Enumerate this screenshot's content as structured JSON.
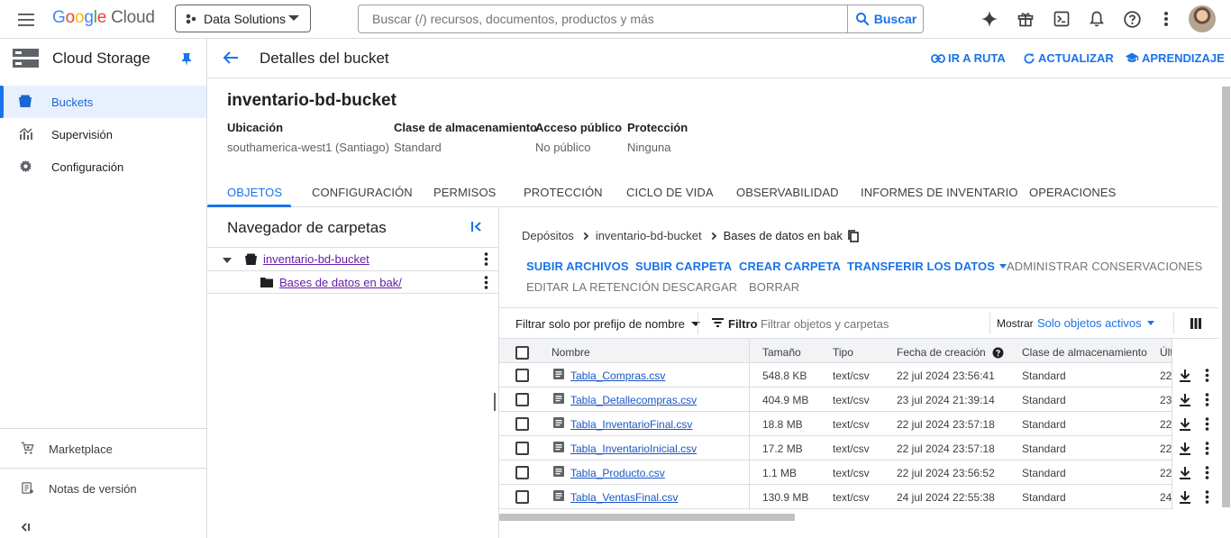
{
  "topbar": {
    "logo_letters": [
      "G",
      "o",
      "o",
      "g",
      "l",
      "e"
    ],
    "logo_suffix": "Cloud",
    "project": "Data Solutions",
    "search_placeholder": "Buscar (/) recursos, documentos, productos y más",
    "search_button": "Buscar",
    "icons": [
      "gemini-icon",
      "gift-icon",
      "cloud-shell-icon",
      "notifications-icon",
      "help-icon",
      "more-vert-icon"
    ]
  },
  "nav": {
    "product": "Cloud Storage",
    "items": [
      {
        "label": "Buckets",
        "icon": "bucket-icon",
        "active": true
      },
      {
        "label": "Supervisión",
        "icon": "monitoring-icon",
        "active": false
      },
      {
        "label": "Configuración",
        "icon": "settings-icon",
        "active": false
      }
    ],
    "bottom": [
      {
        "label": "Marketplace",
        "icon": "cart-icon"
      },
      {
        "label": "Notas de versión",
        "icon": "release-notes-icon"
      }
    ],
    "collapse": "<|"
  },
  "header": {
    "title": "Detalles del bucket",
    "actions": [
      {
        "label": "IR A RUTA",
        "icon": "link-icon"
      },
      {
        "label": "ACTUALIZAR",
        "icon": "refresh-icon"
      },
      {
        "label": "APRENDIZAJE",
        "icon": "school-icon"
      }
    ]
  },
  "bucket": {
    "name": "inventario-bd-bucket",
    "meta": [
      {
        "label": "Ubicación",
        "value": "southamerica-west1 (Santiago)"
      },
      {
        "label": "Clase de almacenamiento",
        "value": "Standard"
      },
      {
        "label": "Acceso público",
        "value": "No público"
      },
      {
        "label": "Protección",
        "value": "Ninguna"
      }
    ]
  },
  "tabs": [
    "OBJETOS",
    "CONFIGURACIÓN",
    "PERMISOS",
    "PROTECCIÓN",
    "CICLO DE VIDA",
    "OBSERVABILIDAD",
    "INFORMES DE INVENTARIO",
    "OPERACIONES"
  ],
  "folder_browser": {
    "title": "Navegador de carpetas",
    "root": "inventario-bd-bucket",
    "child": "Bases de datos en bak/"
  },
  "breadcrumb": [
    "Depósitos",
    "inventario-bd-bucket",
    "Bases de datos en bak"
  ],
  "actions": {
    "primary": [
      {
        "label": "SUBIR ARCHIVOS",
        "enabled": true
      },
      {
        "label": "SUBIR CARPETA",
        "enabled": true
      },
      {
        "label": "CREAR CARPETA",
        "enabled": true
      },
      {
        "label": "TRANSFERIR LOS DATOS",
        "enabled": true
      },
      {
        "label": "ADMINISTRAR CONSERVACIONES",
        "enabled": false
      }
    ],
    "secondary": [
      {
        "label": "EDITAR LA RETENCIÓN",
        "enabled": false
      },
      {
        "label": "DESCARGAR",
        "enabled": false
      },
      {
        "label": "BORRAR",
        "enabled": false
      }
    ]
  },
  "filter": {
    "prefix_select": "Filtrar solo por prefijo de nombre",
    "label": "Filtro",
    "placeholder": "Filtrar objetos y carpetas",
    "show_label": "Mostrar",
    "show_value": "Solo objetos activos"
  },
  "table": {
    "columns": [
      "Nombre",
      "Tamaño",
      "Tipo",
      "Fecha de creación",
      "Clase de almacenamiento",
      "Últ"
    ],
    "rows": [
      {
        "name": "Tabla_Compras.csv",
        "size": "548.8 KB",
        "type": "text/csv",
        "created": "22 jul 2024 23:56:41",
        "class": "Standard",
        "last": "22"
      },
      {
        "name": "Tabla_Detallecompras.csv",
        "size": "404.9 MB",
        "type": "text/csv",
        "created": "23 jul 2024 21:39:14",
        "class": "Standard",
        "last": "23"
      },
      {
        "name": "Tabla_InventarioFinal.csv",
        "size": "18.8 MB",
        "type": "text/csv",
        "created": "22 jul 2024 23:57:18",
        "class": "Standard",
        "last": "22"
      },
      {
        "name": "Tabla_InventarioInicial.csv",
        "size": "17.2 MB",
        "type": "text/csv",
        "created": "22 jul 2024 23:57:18",
        "class": "Standard",
        "last": "22"
      },
      {
        "name": "Tabla_Producto.csv",
        "size": "1.1 MB",
        "type": "text/csv",
        "created": "22 jul 2024 23:56:52",
        "class": "Standard",
        "last": "22"
      },
      {
        "name": "Tabla_VentasFinal.csv",
        "size": "130.9 MB",
        "type": "text/csv",
        "created": "24 jul 2024 22:55:38",
        "class": "Standard",
        "last": "24"
      }
    ]
  },
  "colors": {
    "accent": "#1a73e8",
    "active_bg": "#e8f0fe",
    "visited_link": "#681da8"
  }
}
